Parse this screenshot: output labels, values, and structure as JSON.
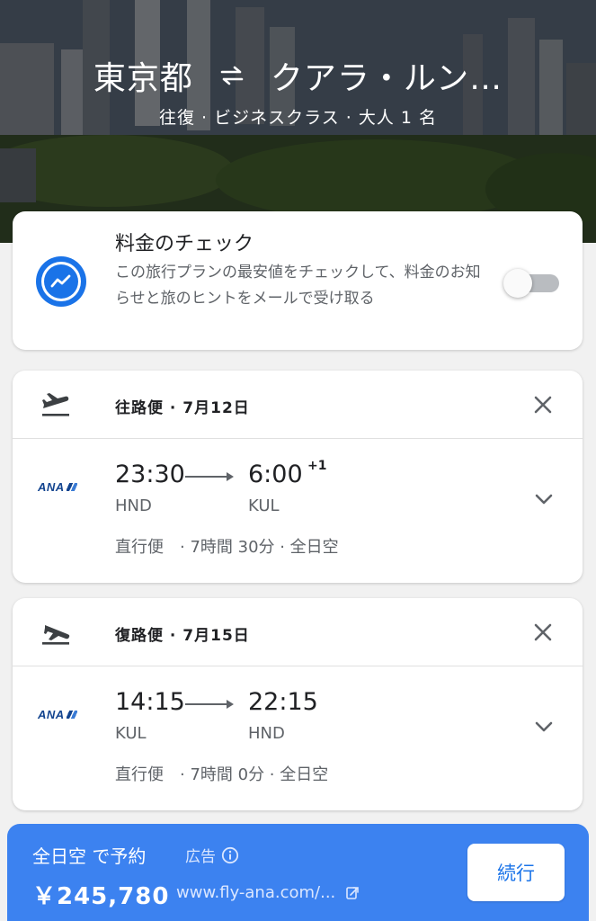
{
  "header": {
    "origin": "東京都",
    "destination": "クアラ・ルン…",
    "swap_icon": "swap-icon",
    "subtitle": "往復 · ビジネスクラス · 大人 1 名"
  },
  "price_tracking": {
    "icon": "trending-icon",
    "title": "料金のチェック",
    "description": "この旅行プランの最安値をチェックして、料金のお知らせと旅のヒントをメールで受け取る",
    "toggle_on": false
  },
  "outbound": {
    "icon": "takeoff-icon",
    "label": "往路便 · 7月12日",
    "airline_logo": "ANA",
    "dep_time": "23:30",
    "arr_time": "6:00",
    "day_offset": "+1",
    "dep_code": "HND",
    "arr_code": "KUL",
    "stops": "直行便",
    "details": "· 7時間 30分 · 全日空"
  },
  "return": {
    "icon": "landing-icon",
    "label": "復路便 · 7月15日",
    "airline_logo": "ANA",
    "dep_time": "14:15",
    "arr_time": "22:15",
    "dep_code": "KUL",
    "arr_code": "HND",
    "stops": "直行便",
    "details": "· 7時間 0分 · 全日空"
  },
  "booking": {
    "title": "全日空 で予約",
    "ad_label": "広告",
    "price": "￥245,780",
    "url": "www.fly-ana.com/...",
    "continue_label": "続行"
  },
  "colors": {
    "accent": "#1a73e8",
    "booking_bar": "#3c82f0",
    "airline": "#13448f"
  }
}
